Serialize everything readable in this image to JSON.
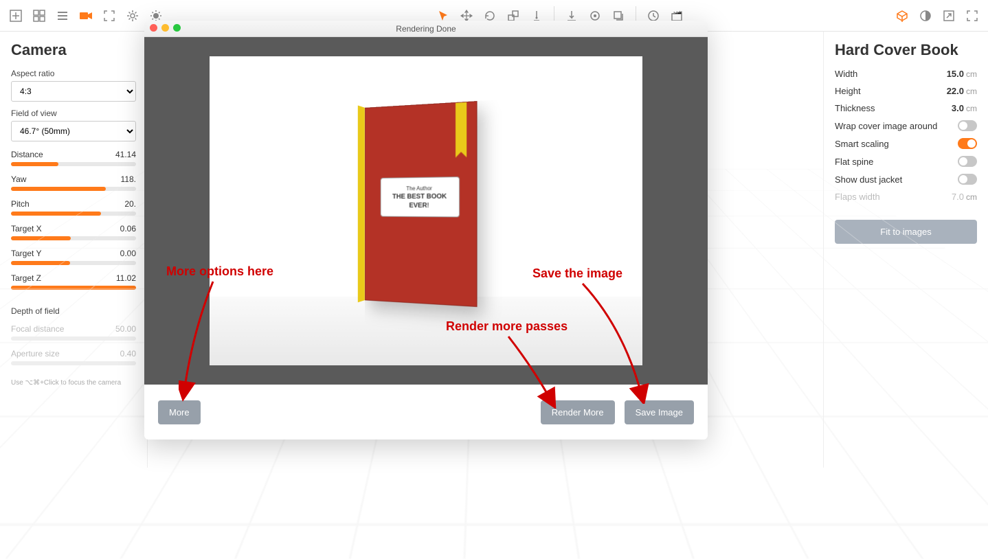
{
  "toolbar": {
    "left_icons": [
      "add",
      "grid",
      "list",
      "camera",
      "focus-frame",
      "gear",
      "brightness"
    ],
    "center_icons": [
      "pointer",
      "move",
      "rotate",
      "scale",
      "snap",
      "align-bottom",
      "orbit",
      "shadow",
      "clock",
      "clapper"
    ],
    "right_icons": [
      "cube",
      "contrast",
      "maximize",
      "fullscreen"
    ]
  },
  "camera_panel": {
    "title": "Camera",
    "aspect_label": "Aspect ratio",
    "aspect_value": "4:3",
    "fov_label": "Field of view",
    "fov_value": "46.7° (50mm)",
    "sliders": [
      {
        "label": "Distance",
        "value": "41.14",
        "fill": 38
      },
      {
        "label": "Yaw",
        "value": "118.",
        "fill": 76
      },
      {
        "label": "Pitch",
        "value": "20.",
        "fill": 72
      },
      {
        "label": "Target X",
        "value": "0.06",
        "fill": 48
      },
      {
        "label": "Target Y",
        "value": "0.00",
        "fill": 47
      },
      {
        "label": "Target Z",
        "value": "11.02",
        "fill": 100
      }
    ],
    "dof_label": "Depth of field",
    "focal_label": "Focal distance",
    "focal_value": "50.00",
    "aperture_label": "Aperture size",
    "aperture_value": "0.40",
    "hint": "Use ⌥⌘+Click to focus the camera"
  },
  "right_panel": {
    "title": "Hard Cover Book",
    "props": [
      {
        "label": "Width",
        "value": "15.0",
        "unit": "cm"
      },
      {
        "label": "Height",
        "value": "22.0",
        "unit": "cm"
      },
      {
        "label": "Thickness",
        "value": "3.0",
        "unit": "cm"
      }
    ],
    "toggles": [
      {
        "label": "Wrap cover image around",
        "on": false
      },
      {
        "label": "Smart scaling",
        "on": true
      },
      {
        "label": "Flat spine",
        "on": false
      },
      {
        "label": "Show dust jacket",
        "on": false
      }
    ],
    "flaps_label": "Flaps width",
    "flaps_value": "7.0",
    "flaps_unit": "cm",
    "fit_button": "Fit to images"
  },
  "modal": {
    "title": "Rendering Done",
    "more_btn": "More",
    "render_more_btn": "Render More",
    "save_btn": "Save Image",
    "book_author": "The Author",
    "book_title_1": "THE BEST BOOK",
    "book_title_2": "EVER!"
  },
  "annotations": {
    "more": "More options here",
    "render": "Render more passes",
    "save": "Save the image"
  }
}
